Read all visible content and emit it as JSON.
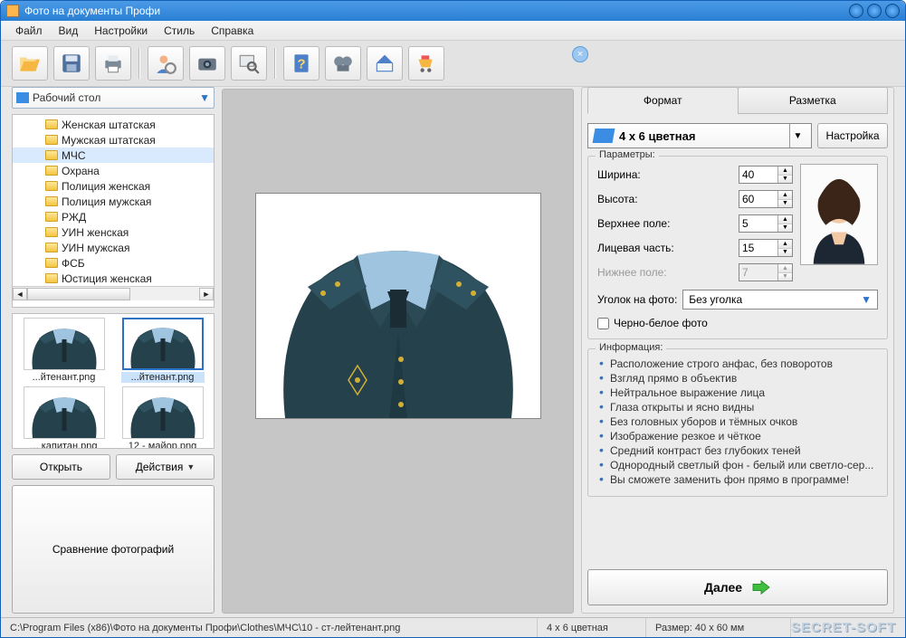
{
  "title": "Фото на документы Профи",
  "menu": [
    "Файл",
    "Вид",
    "Настройки",
    "Стиль",
    "Справка"
  ],
  "toolbar_icons": [
    "open-icon",
    "save-icon",
    "print-icon",
    "person-icon",
    "camera-icon",
    "search-icon",
    "help-icon",
    "film-icon",
    "home-icon",
    "cart-icon"
  ],
  "location_combo": "Рабочий стол",
  "tree_items": [
    {
      "label": "Женская штатская",
      "selected": false
    },
    {
      "label": "Мужская штатская",
      "selected": false
    },
    {
      "label": "МЧС",
      "selected": true
    },
    {
      "label": "Охрана",
      "selected": false
    },
    {
      "label": "Полиция женская",
      "selected": false
    },
    {
      "label": "Полиция мужская",
      "selected": false
    },
    {
      "label": "РЖД",
      "selected": false
    },
    {
      "label": "УИН женская",
      "selected": false
    },
    {
      "label": "УИН мужская",
      "selected": false
    },
    {
      "label": "ФСБ",
      "selected": false
    },
    {
      "label": "Юстиция женская",
      "selected": false
    }
  ],
  "thumbs": [
    {
      "cap": "...йтенант.png",
      "selected": false
    },
    {
      "cap": "...йтенант.png",
      "selected": true
    },
    {
      "cap": "... капитан.png",
      "selected": false
    },
    {
      "cap": "12 - майор.png",
      "selected": false
    },
    {
      "cap": "",
      "selected": false
    },
    {
      "cap": "",
      "selected": false
    }
  ],
  "btn_open": "Открыть",
  "btn_actions": "Действия",
  "btn_compare": "Сравнение фотографий",
  "tabs": {
    "format": "Формат",
    "markup": "Разметка",
    "active": 0
  },
  "format_combo": "4 x 6 цветная",
  "btn_format_settings": "Настройка",
  "fieldset_params": "Параметры:",
  "params": {
    "width": {
      "lbl": "Ширина:",
      "val": "40"
    },
    "height": {
      "lbl": "Высота:",
      "val": "60"
    },
    "top": {
      "lbl": "Верхнее поле:",
      "val": "5"
    },
    "face": {
      "lbl": "Лицевая часть:",
      "val": "15"
    },
    "bottom": {
      "lbl": "Нижнее поле:",
      "val": "7"
    }
  },
  "corner_lbl": "Уголок на фото:",
  "corner_val": "Без уголка",
  "cb_bw": "Черно-белое фото",
  "fieldset_info": "Информация:",
  "info_items": [
    "Расположение строго анфас, без поворотов",
    "Взгляд прямо в объектив",
    "Нейтральное выражение лица",
    "Глаза открыты и ясно видны",
    "Без головных уборов и тёмных очков",
    "Изображение резкое и чёткое",
    "Средний контраст без глубоких теней",
    "Однородный светлый фон - белый или светло-сер...",
    "Вы сможете заменить фон прямо в программе!"
  ],
  "btn_next": "Далее",
  "status_path": "C:\\Program Files (x86)\\Фото на документы Профи\\Clothes\\МЧС\\10 - ст-лейтенант.png",
  "status_format": "4 x 6 цветная",
  "status_size": "Размер: 40 x 60 мм",
  "watermark": "SECRET-SOFT"
}
